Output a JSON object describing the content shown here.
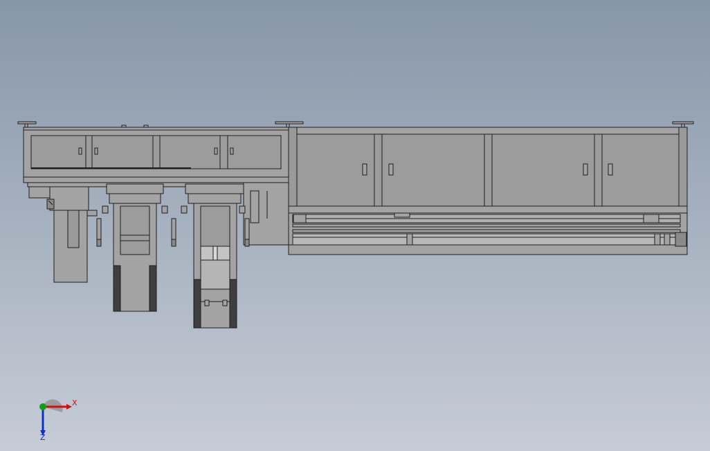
{
  "viewport": {
    "background_top": "#8796a9",
    "background_bottom": "#c6ccd6",
    "part_fill": "#a3a3a3",
    "part_fill_dark": "#8a8a8a",
    "part_edge": "#1e1e1e",
    "shadow_fill": "#3f3f3f"
  },
  "triad": {
    "x_label": "X",
    "z_label": "Z",
    "x_color": "#d01010",
    "y_color": "#10a010",
    "z_color": "#1030c0"
  }
}
